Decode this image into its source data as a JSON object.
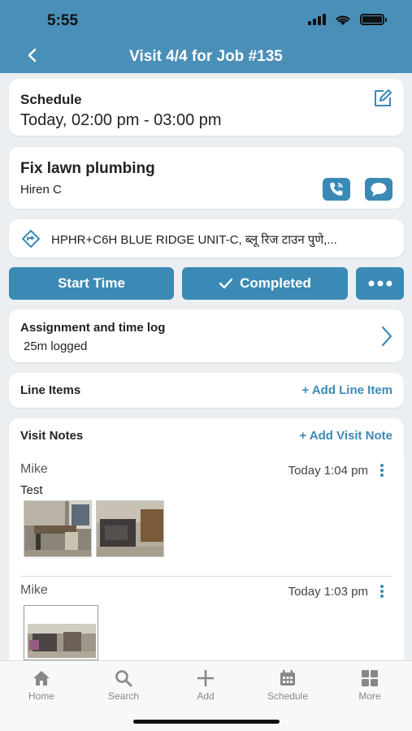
{
  "status_bar": {
    "time": "5:55"
  },
  "header": {
    "title": "Visit 4/4 for Job #135"
  },
  "schedule": {
    "label": "Schedule",
    "value": "Today, 02:00 pm - 03:00 pm"
  },
  "job": {
    "title": "Fix lawn plumbing",
    "client": "Hiren C"
  },
  "address": {
    "text": "HPHR+C6H BLUE RIDGE UNIT-C, ब्लू रिज टाउन पुणे,..."
  },
  "actions": {
    "start_time": "Start Time",
    "completed": "Completed"
  },
  "assignment": {
    "title": "Assignment and time log",
    "logged": "25m logged"
  },
  "line_items": {
    "title": "Line Items",
    "add_label": "+ Add Line Item"
  },
  "visit_notes": {
    "title": "Visit Notes",
    "add_label": "+ Add Visit Note",
    "notes": [
      {
        "author": "Mike",
        "time": "Today 1:04 pm",
        "text": "Test"
      },
      {
        "author": "Mike",
        "time": "Today 1:03 pm",
        "text": ""
      }
    ]
  },
  "tabbar": {
    "items": [
      {
        "label": "Home",
        "icon": "home-icon"
      },
      {
        "label": "Search",
        "icon": "search-icon"
      },
      {
        "label": "Add",
        "icon": "plus-icon"
      },
      {
        "label": "Schedule",
        "icon": "calendar-icon"
      },
      {
        "label": "More",
        "icon": "grid-icon"
      }
    ]
  },
  "colors": {
    "header": "#4a8fb8",
    "accent": "#3b8ab5",
    "background": "#eceff1"
  }
}
